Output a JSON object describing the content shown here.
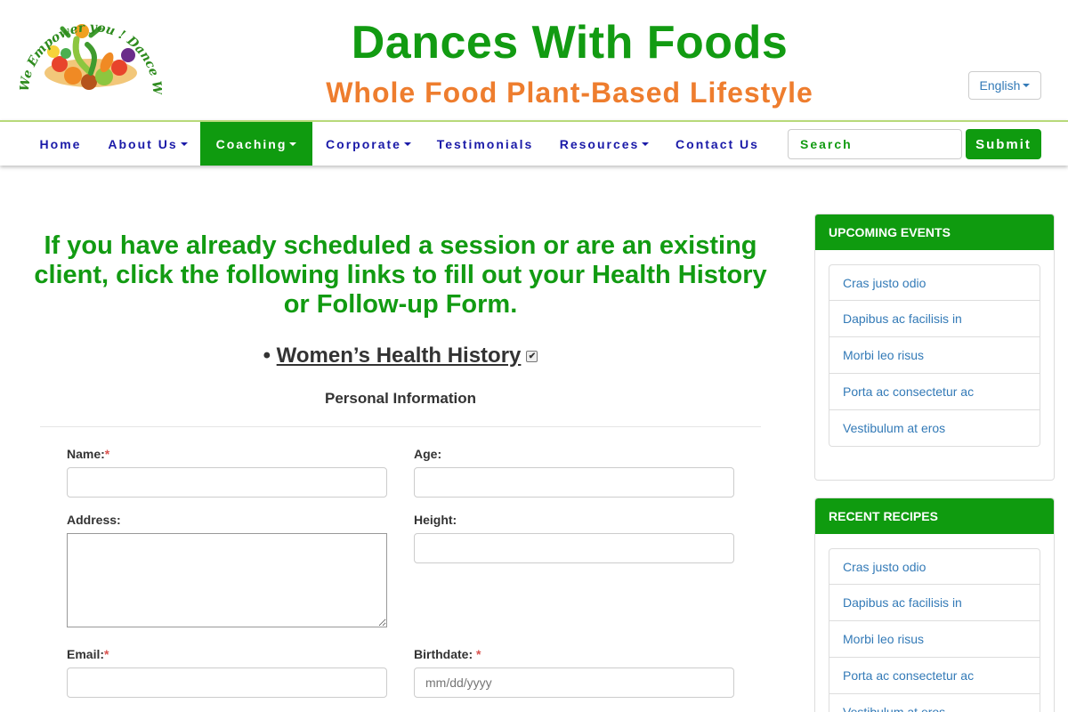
{
  "header": {
    "logo_text_top": "We Empower you ! Dance With Foods",
    "site_title": "Dances With Foods",
    "site_subtitle": "Whole Food Plant-Based Lifestyle",
    "language": "English"
  },
  "nav": {
    "items": [
      {
        "label": "Home",
        "dropdown": false
      },
      {
        "label": "About Us",
        "dropdown": true
      },
      {
        "label": "Coaching ",
        "dropdown": true,
        "active": true
      },
      {
        "label": "Corporate",
        "dropdown": true
      },
      {
        "label": "Testimonials",
        "dropdown": false
      },
      {
        "label": "Resources",
        "dropdown": true
      },
      {
        "label": "Contact Us",
        "dropdown": false
      }
    ],
    "search_placeholder": "Search",
    "submit_label": "Submit"
  },
  "main": {
    "heading": "If you have already scheduled a session or are an existing client, click the following links to fill out your Health History or Follow-up Form.",
    "bullet": "•",
    "form_link": "Women’s Health History",
    "section_title": "Personal Information",
    "fields": {
      "name_label": "Name:",
      "age_label": "Age:",
      "address_label": "Address:",
      "height_label": "Height:",
      "email_label": "Email:",
      "birthdate_label": "Birthdate: ",
      "birthdate_placeholder": "mm/dd/yyyy",
      "required_mark": "*"
    }
  },
  "sidebar": {
    "upcoming_events": {
      "title": "UPCOMING EVENTS",
      "items": [
        "Cras justo odio",
        "Dapibus ac facilisis in",
        "Morbi leo risus",
        "Porta ac consectetur ac",
        "Vestibulum at eros"
      ]
    },
    "recent_recipes": {
      "title": "RECENT RECIPES",
      "items": [
        "Cras justo odio",
        "Dapibus ac facilisis in",
        "Morbi leo risus",
        "Porta ac consectetur ac",
        "Vestibulum at eros"
      ]
    }
  },
  "colors": {
    "brand_green": "#129b12",
    "brand_orange": "#ee7d2e",
    "nav_blue": "#1a1aa8",
    "link_blue": "#337ab7"
  }
}
